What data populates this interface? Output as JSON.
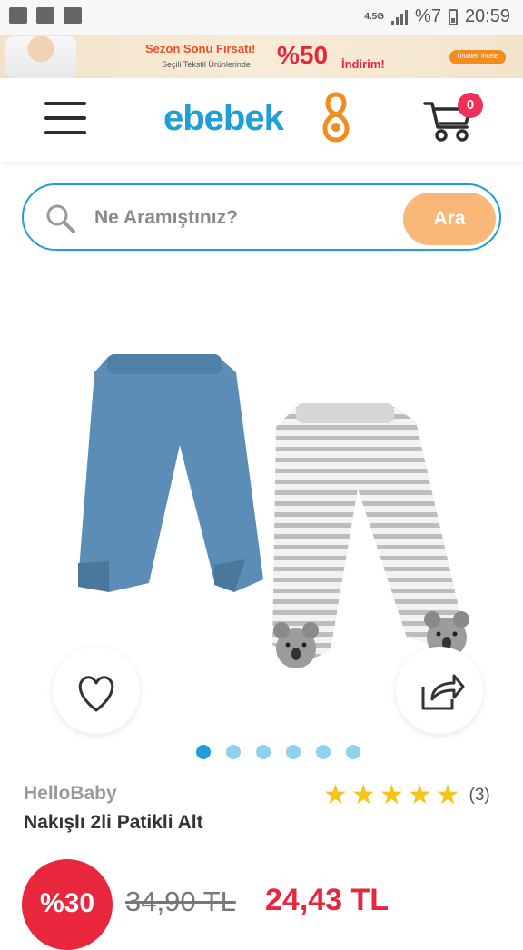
{
  "status_bar": {
    "network": "4.5G",
    "battery": "%7",
    "time": "20:59"
  },
  "promo_banner": {
    "title": "Sezon Sonu Fırsatı!",
    "subtitle": "Seçili Tekstil Ürünlerinde",
    "percent": "%50",
    "discount_word": "İndirim!",
    "button_label": "Ürünleri İncele"
  },
  "header": {
    "logo": "ebebek",
    "cart_count": "0"
  },
  "search": {
    "placeholder": "Ne Aramıştınız?",
    "button_label": "Ara"
  },
  "gallery": {
    "image_count": 6,
    "active_index": 0
  },
  "product": {
    "brand": "HelloBaby",
    "name": "Nakışlı 2li Patikli Alt",
    "rating": 5,
    "review_count": "(3)",
    "discount_badge": "%30",
    "old_price": "34,90 TL",
    "new_price": "24,43 TL"
  },
  "colors": {
    "brand_blue": "#1f9fd6",
    "price_red": "#e8263c",
    "search_button": "#f9b87a",
    "star": "#f5c518"
  }
}
